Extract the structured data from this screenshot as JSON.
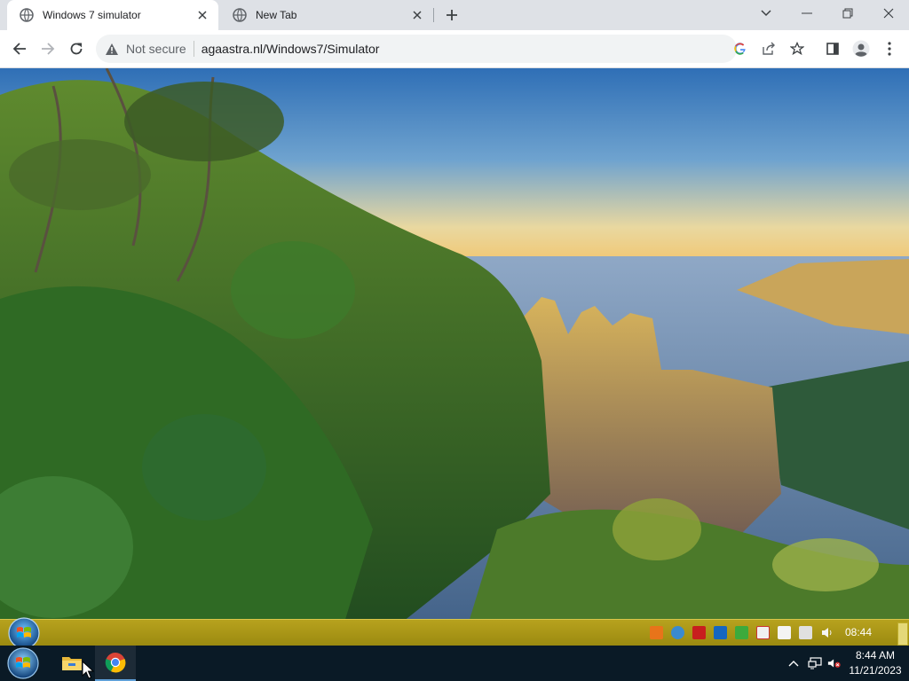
{
  "browser": {
    "tabs": [
      {
        "title": "Windows 7 simulator",
        "active": true
      },
      {
        "title": "New Tab",
        "active": false
      }
    ],
    "new_tab_icon": "plus-icon",
    "security_label": "Not secure",
    "url": "agaastra.nl/Windows7/Simulator",
    "window_controls": [
      "tab-search-icon",
      "minimize-icon",
      "restore-icon",
      "close-icon"
    ],
    "toolbar_icons": [
      "back-icon",
      "forward-icon",
      "reload-icon",
      "google-icon",
      "share-icon",
      "bookmark-star-icon",
      "side-panel-icon",
      "profile-icon",
      "menu-icon"
    ]
  },
  "simulator": {
    "wallpaper": "Blue Mountains Three Sisters landscape",
    "taskbar_color": "#a8951a",
    "clock": "08:44",
    "tray_icons": [
      "orange-app-icon",
      "network-globe-icon",
      "pdf-icon",
      "outlook-icon",
      "security-check-icon",
      "flag-icon",
      "usb-icon",
      "display-icon",
      "volume-icon"
    ]
  },
  "taskbar": {
    "apps": [
      "file-explorer-icon",
      "chrome-icon"
    ],
    "time": "8:44 AM",
    "date": "11/21/2023",
    "tray_icons": [
      "show-hidden-icon",
      "network-icon",
      "volume-muted-icon"
    ]
  }
}
